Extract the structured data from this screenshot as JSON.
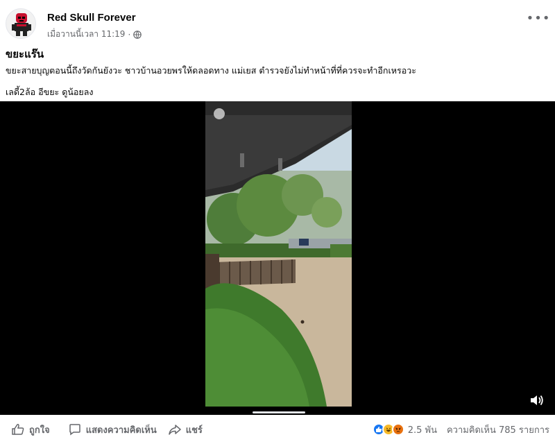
{
  "post": {
    "author": "Red Skull Forever",
    "timestamp": "เมื่อวานนี้เวลา 11:19",
    "privacy_icon": "globe-icon",
    "more_label": "•••",
    "title": "ขยะแร๊น",
    "body_line1": "ขยะสายบุญตอนนี้ถึงวัดกันยังวะ ชาวบ้านอวยพรให้ดลอดทาง แม่เยส ตำรวจยังไม่ทำหน้าที่ที่ควรจะทำอีกเหรอวะ",
    "body_line2": "เลดี้2ล้อ อีขยะ ดูน้อยลง"
  },
  "video": {
    "sound_icon": "speaker-icon",
    "progress_fraction": 0.0
  },
  "actions": {
    "like_label": "ถูกใจ",
    "comment_label": "แสดงความคิดเห็น",
    "share_label": "แชร์"
  },
  "stats": {
    "reaction_icons": [
      "like-reaction-icon",
      "haha-reaction-icon",
      "angry-reaction-icon"
    ],
    "reaction_count": "2.5 พัน",
    "comment_count": "ความคิดเห็น 785 รายการ"
  },
  "colors": {
    "like_blue": "#1877f2",
    "haha_yellow": "#f7b928",
    "angry_orange": "#e9710f",
    "secondary_text": "#65676b"
  }
}
